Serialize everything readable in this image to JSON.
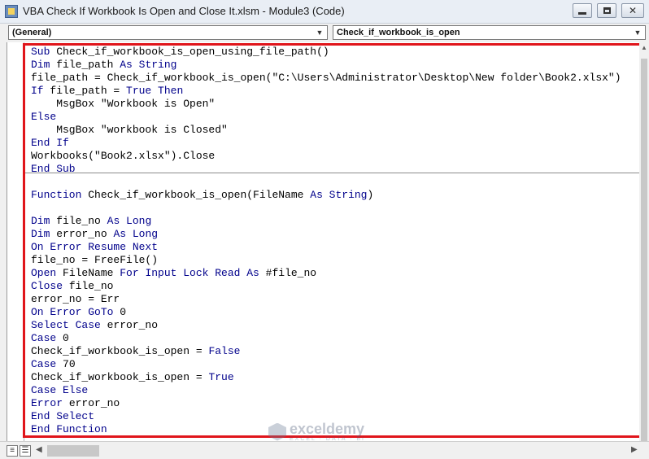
{
  "window": {
    "title": "VBA Check If Workbook Is Open and Close It.xlsm - Module3 (Code)"
  },
  "toolbar": {
    "object_combo": "(General)",
    "procedure_combo": "Check_if_workbook_is_open"
  },
  "code": {
    "sub_lines": [
      [
        {
          "t": "Sub ",
          "k": 1
        },
        {
          "t": "Check_if_workbook_is_open_using_file_path()",
          "k": 0
        }
      ],
      [
        {
          "t": "Dim ",
          "k": 1
        },
        {
          "t": "file_path ",
          "k": 0
        },
        {
          "t": "As String",
          "k": 1
        }
      ],
      [
        {
          "t": "file_path = Check_if_workbook_is_open(\"C:\\Users\\Administrator\\Desktop\\New folder\\Book2.xlsx\")",
          "k": 0
        }
      ],
      [
        {
          "t": "If ",
          "k": 1
        },
        {
          "t": "file_path = ",
          "k": 0
        },
        {
          "t": "True Then",
          "k": 1
        }
      ],
      [
        {
          "t": "    MsgBox \"Workbook is Open\"",
          "k": 0
        }
      ],
      [
        {
          "t": "Else",
          "k": 1
        }
      ],
      [
        {
          "t": "    MsgBox \"workbook is Closed\"",
          "k": 0
        }
      ],
      [
        {
          "t": "End If",
          "k": 1
        }
      ],
      [
        {
          "t": "Workbooks(\"Book2.xlsx\").Close",
          "k": 0
        }
      ],
      [
        {
          "t": "End Sub",
          "k": 1
        }
      ]
    ],
    "function_lines": [
      [
        {
          "t": "",
          "k": 0
        }
      ],
      [
        {
          "t": "Function ",
          "k": 1
        },
        {
          "t": "Check_if_workbook_is_open(FileName ",
          "k": 0
        },
        {
          "t": "As String",
          "k": 1
        },
        {
          "t": ")",
          "k": 0
        }
      ],
      [
        {
          "t": "",
          "k": 0
        }
      ],
      [
        {
          "t": "Dim ",
          "k": 1
        },
        {
          "t": "file_no ",
          "k": 0
        },
        {
          "t": "As Long",
          "k": 1
        }
      ],
      [
        {
          "t": "Dim ",
          "k": 1
        },
        {
          "t": "error_no ",
          "k": 0
        },
        {
          "t": "As Long",
          "k": 1
        }
      ],
      [
        {
          "t": "On Error Resume Next",
          "k": 1
        }
      ],
      [
        {
          "t": "file_no = FreeFile()",
          "k": 0
        }
      ],
      [
        {
          "t": "Open ",
          "k": 1
        },
        {
          "t": "FileName ",
          "k": 0
        },
        {
          "t": "For Input Lock Read As ",
          "k": 1
        },
        {
          "t": "#file_no",
          "k": 0
        }
      ],
      [
        {
          "t": "Close ",
          "k": 1
        },
        {
          "t": "file_no",
          "k": 0
        }
      ],
      [
        {
          "t": "error_no = Err",
          "k": 0
        }
      ],
      [
        {
          "t": "On Error GoTo ",
          "k": 1
        },
        {
          "t": "0",
          "k": 0
        }
      ],
      [
        {
          "t": "Select Case ",
          "k": 1
        },
        {
          "t": "error_no",
          "k": 0
        }
      ],
      [
        {
          "t": "Case ",
          "k": 1
        },
        {
          "t": "0",
          "k": 0
        }
      ],
      [
        {
          "t": "Check_if_workbook_is_open = ",
          "k": 0
        },
        {
          "t": "False",
          "k": 1
        }
      ],
      [
        {
          "t": "Case ",
          "k": 1
        },
        {
          "t": "70",
          "k": 0
        }
      ],
      [
        {
          "t": "Check_if_workbook_is_open = ",
          "k": 0
        },
        {
          "t": "True",
          "k": 1
        }
      ],
      [
        {
          "t": "Case Else",
          "k": 1
        }
      ],
      [
        {
          "t": "Error ",
          "k": 1
        },
        {
          "t": "error_no",
          "k": 0
        }
      ],
      [
        {
          "t": "End Select",
          "k": 1
        }
      ],
      [
        {
          "t": "End Function",
          "k": 1
        }
      ]
    ]
  },
  "watermark": {
    "name": "exceldemy",
    "tagline": "EXCEL · DATA · BI"
  },
  "colors": {
    "keyword": "#00008b",
    "highlight_border": "#e0151b"
  }
}
